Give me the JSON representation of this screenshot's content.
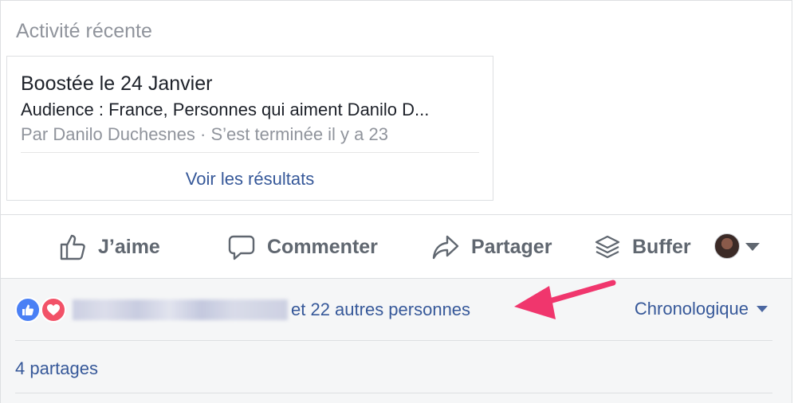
{
  "activity": {
    "title": "Activité récente",
    "boost_title": "Boostée le 24 Janvier",
    "audience": "Audience : France, Personnes qui aiment Danilo D...",
    "meta": "Par Danilo Duchesnes · S’est terminée il y a 23",
    "results_link": "Voir les résultats"
  },
  "actions": {
    "like": "J’aime",
    "comment": "Commenter",
    "share": "Partager",
    "buffer": "Buffer"
  },
  "reactions": {
    "others_text": "et 22 autres personnes",
    "order_label": "Chronologique",
    "shares": "4 partages"
  },
  "colors": {
    "link": "#365899",
    "action_text": "#606770",
    "like_blue": "#4a80f5",
    "love_red": "#f25268",
    "arrow_pink": "#f0366d"
  }
}
